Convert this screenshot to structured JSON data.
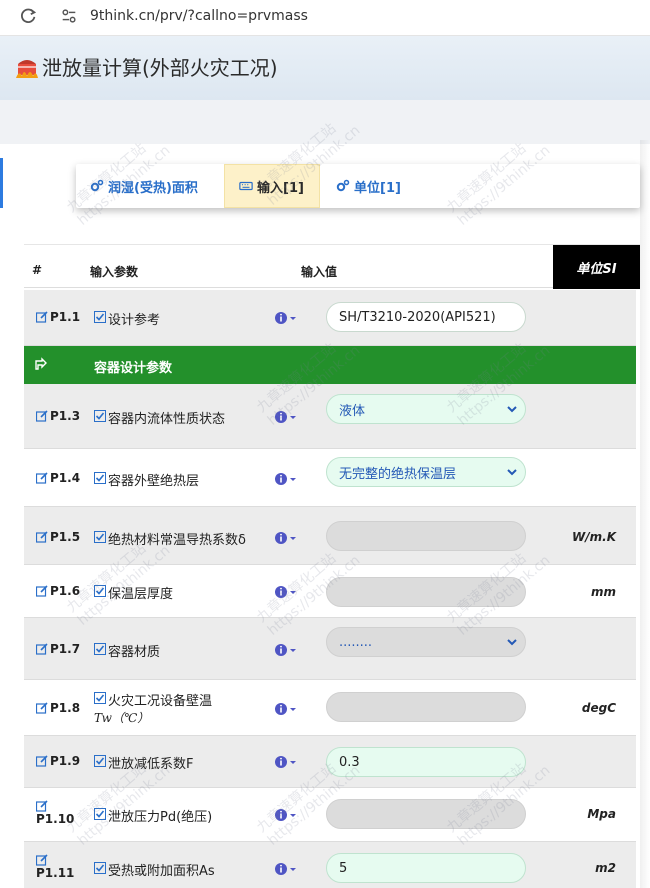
{
  "browser": {
    "url": "9think.cn/prv/?callno=prvmass"
  },
  "header": {
    "title": "泄放量计算(外部火灾工况)"
  },
  "tabs": [
    {
      "label": "润湿(受热)面积",
      "active": false
    },
    {
      "label": "输入[1]",
      "active": true
    },
    {
      "label": "单位[1]",
      "active": false
    }
  ],
  "table": {
    "col_index": "#",
    "col_param": "输入参数",
    "col_value": "输入值",
    "col_unit": "单位SI"
  },
  "section": {
    "label": "容器设计参数"
  },
  "rows": [
    {
      "id": "P1.1",
      "name": "设计参考",
      "value": "SH/T3210-2020(API521)",
      "unit": ""
    },
    {
      "id": "P1.3",
      "name": "容器内流体性质状态",
      "value": "液体",
      "unit": ""
    },
    {
      "id": "P1.4",
      "name": "容器外壁绝热层",
      "value": "无完整的绝热保温层",
      "unit": ""
    },
    {
      "id": "P1.5",
      "name": "绝热材料常温导热系数δ",
      "value": "",
      "unit": "W/m.K"
    },
    {
      "id": "P1.6",
      "name": "保温层厚度",
      "value": "",
      "unit": "mm"
    },
    {
      "id": "P1.7",
      "name": "容器材质",
      "value": "........",
      "unit": ""
    },
    {
      "id": "P1.8",
      "name_line1": "火灾工况设备壁温",
      "name_line2": "Tw（℃）",
      "value": "",
      "unit": "degC"
    },
    {
      "id": "P1.9",
      "name": "泄放减低系数F",
      "value": "0.3",
      "unit": ""
    },
    {
      "id": "P1.10",
      "name": "泄放压力Pd(绝压)",
      "value": "",
      "unit": "Mpa"
    },
    {
      "id": "P1.11",
      "name": "受热或附加面积As",
      "value": "5",
      "unit": "m2"
    }
  ],
  "watermark": {
    "line1": "九章速算化工站",
    "line2": "https://9think.cn"
  },
  "colors": {
    "accent": "#2a6fc9",
    "section": "#23902b",
    "input_green": "#e6fbf0",
    "tab_active": "#fdf1c9"
  }
}
